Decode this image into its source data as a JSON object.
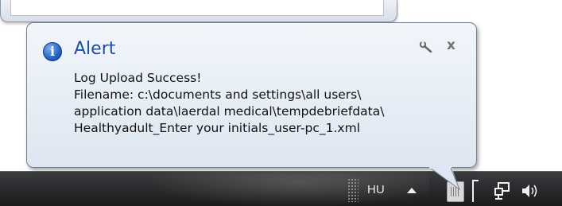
{
  "balloon": {
    "title": "Alert",
    "icon": "info-icon",
    "lines": [
      "Log Upload Success!",
      "Filename: c:\\documents and settings\\all users\\",
      "application data\\laerdal medical\\tempdebriefdata\\",
      "Healthyadult_Enter your initials_user-pc_1.xml"
    ],
    "close_glyph": "x",
    "settings_icon": "wrench-icon",
    "title_color": "#1e4fa8"
  },
  "taskbar": {
    "language": "HU",
    "tray_icons": [
      "show-hidden-icons-arrow",
      "app-tray-icon",
      "network-icon",
      "volume-icon"
    ]
  }
}
